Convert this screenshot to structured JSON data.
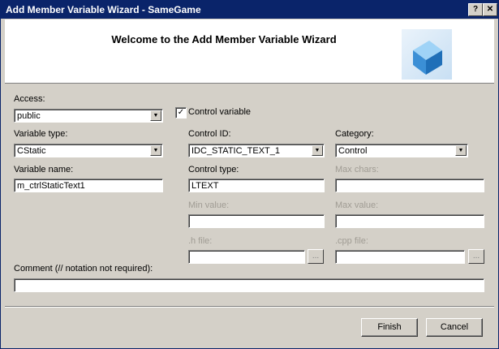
{
  "window": {
    "title": "Add Member Variable Wizard - SameGame",
    "help": "?",
    "close": "✕"
  },
  "banner": {
    "heading": "Welcome to the Add Member Variable Wizard"
  },
  "access": {
    "label": "Access:",
    "value": "public"
  },
  "control_variable": {
    "label": "Control variable",
    "checked": true,
    "check": "✓"
  },
  "variable_type": {
    "label": "Variable type:",
    "value": "CStatic"
  },
  "control_id": {
    "label": "Control ID:",
    "value": "IDC_STATIC_TEXT_1"
  },
  "category": {
    "label": "Category:",
    "value": "Control"
  },
  "variable_name": {
    "label": "Variable name:",
    "value": "m_ctrlStaticText1"
  },
  "control_type": {
    "label": "Control type:",
    "value": "LTEXT"
  },
  "max_chars": {
    "label": "Max chars:",
    "value": ""
  },
  "min_value": {
    "label": "Min value:",
    "value": ""
  },
  "max_value": {
    "label": "Max value:",
    "value": ""
  },
  "h_file": {
    "label": ".h file:",
    "value": "",
    "browse": "..."
  },
  "cpp_file": {
    "label": ".cpp file:",
    "value": "",
    "browse": "..."
  },
  "comment": {
    "label": "Comment (// notation not required):",
    "value": ""
  },
  "buttons": {
    "finish": "Finish",
    "cancel": "Cancel"
  }
}
